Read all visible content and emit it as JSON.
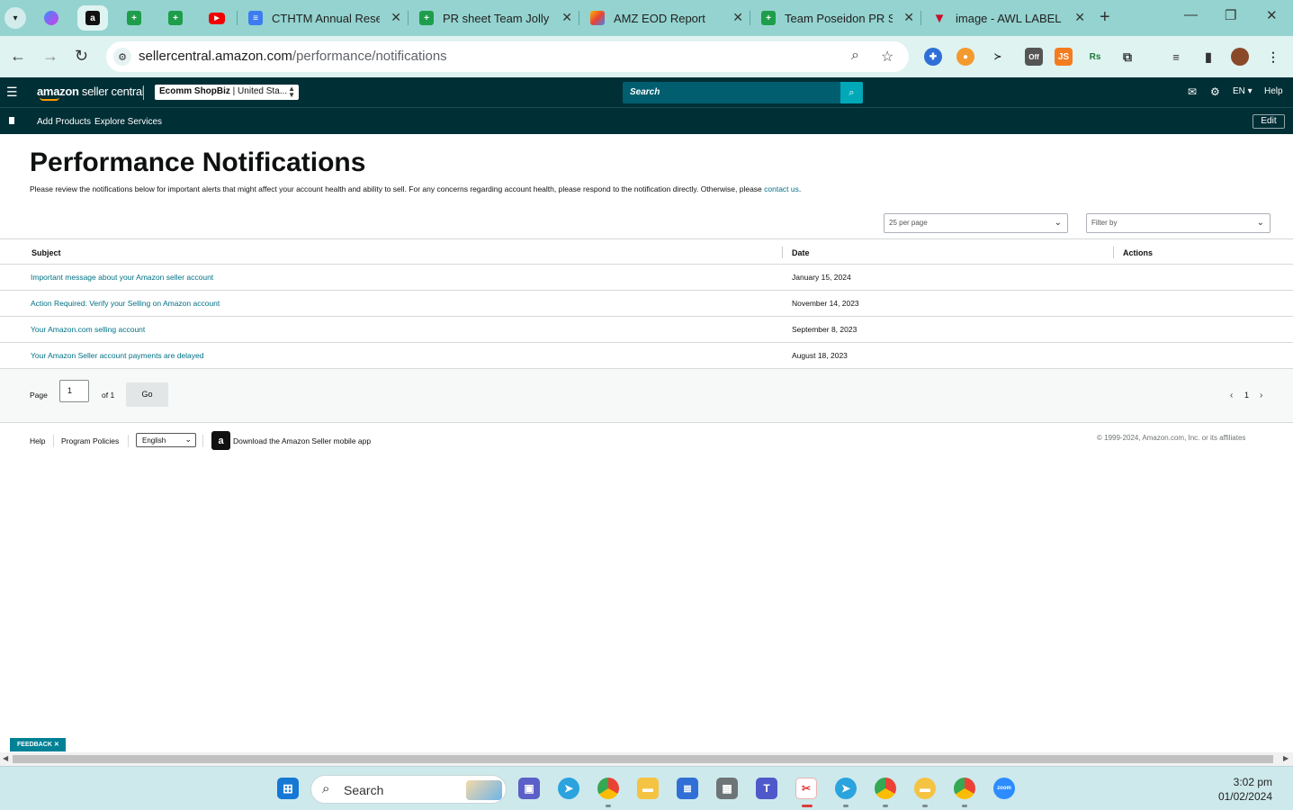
{
  "browser": {
    "tabs": [
      {
        "title": "CTHTM Annual Resear",
        "favicon": "docs-icon"
      },
      {
        "title": "PR sheet Team Jolly - S",
        "favicon": "sheets-icon"
      },
      {
        "title": "AMZ EOD Report",
        "favicon": "eod-icon"
      },
      {
        "title": "Team Poseidon PR She",
        "favicon": "sheets-icon"
      },
      {
        "title": "image - AWL LABEL",
        "favicon": "awl-icon"
      }
    ],
    "url_host": "sellercentral.amazon.com",
    "url_path": "/performance/notifications"
  },
  "header": {
    "logo_brand": "amazon",
    "logo_suffix": " seller central",
    "account_name": "Ecomm ShopBiz",
    "account_region": " | United Sta...",
    "search_placeholder": "Search",
    "language": "EN",
    "help": "Help"
  },
  "subnav": {
    "links": [
      "Add Products",
      "Explore Services"
    ],
    "edit": "Edit"
  },
  "page": {
    "title": "Performance Notifications",
    "description": "Please review the notifications below for important alerts that might affect your account health and ability to sell. For any concerns regarding account health, please respond to the notification directly. Otherwise, please ",
    "contact_link": "contact us",
    "description_end": ".",
    "per_page": "25 per page",
    "filter_placeholder": "Filter by"
  },
  "table": {
    "headers": {
      "subject": "Subject",
      "date": "Date",
      "actions": "Actions"
    },
    "rows": [
      {
        "subject": "Important message about your Amazon seller account",
        "date": "January 15, 2024"
      },
      {
        "subject": "Action Required: Verify your Selling on Amazon account",
        "date": "November 14, 2023"
      },
      {
        "subject": "Your Amazon.com selling account",
        "date": "September 8, 2023"
      },
      {
        "subject": "Your Amazon Seller account payments are delayed",
        "date": "August 18, 2023"
      }
    ]
  },
  "pagination": {
    "page_label": "Page",
    "current": "1",
    "of_label": "of 1",
    "go": "Go",
    "page_number": "1"
  },
  "footer": {
    "help": "Help",
    "policies": "Program Policies",
    "language": "English",
    "app_link": "Download the Amazon Seller mobile app",
    "copyright": "© 1999-2024, Amazon.com, Inc. or its affiliates"
  },
  "feedback": "FEEDBACK ✕",
  "taskbar": {
    "search": "Search",
    "time": "3:02 pm",
    "date": "01/02/2024"
  },
  "colors": {
    "header_bg": "#002f36",
    "link": "#007185",
    "search_bg": "#005e6f",
    "search_button": "#00a8b8",
    "tabstrip": "#94d3cf"
  }
}
